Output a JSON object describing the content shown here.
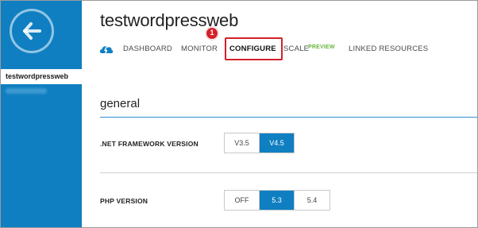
{
  "sidebar": {
    "active_item": "testwordpressweb"
  },
  "header": {
    "site_title": "testwordpressweb",
    "nav": {
      "dashboard": "DASHBOARD",
      "monitor": "MONITOR",
      "configure": "CONFIGURE",
      "scale": "SCALE",
      "scale_badge": "PREVIEW",
      "linked_resources": "LINKED RESOURCES"
    },
    "step_badge": "1",
    "highlight_color": "#d3202a",
    "accent_color": "#0f7fc1"
  },
  "section": {
    "title": "general"
  },
  "settings": {
    "net_framework": {
      "label": ".NET FRAMEWORK VERSION",
      "options": [
        "V3.5",
        "V4.5"
      ],
      "selected": "V4.5"
    },
    "php": {
      "label": "PHP VERSION",
      "options": [
        "OFF",
        "5.3",
        "5.4"
      ],
      "selected": "5.3"
    }
  },
  "icons": {
    "back": "back-arrow-icon",
    "cloud": "cloud-lightning-icon"
  }
}
